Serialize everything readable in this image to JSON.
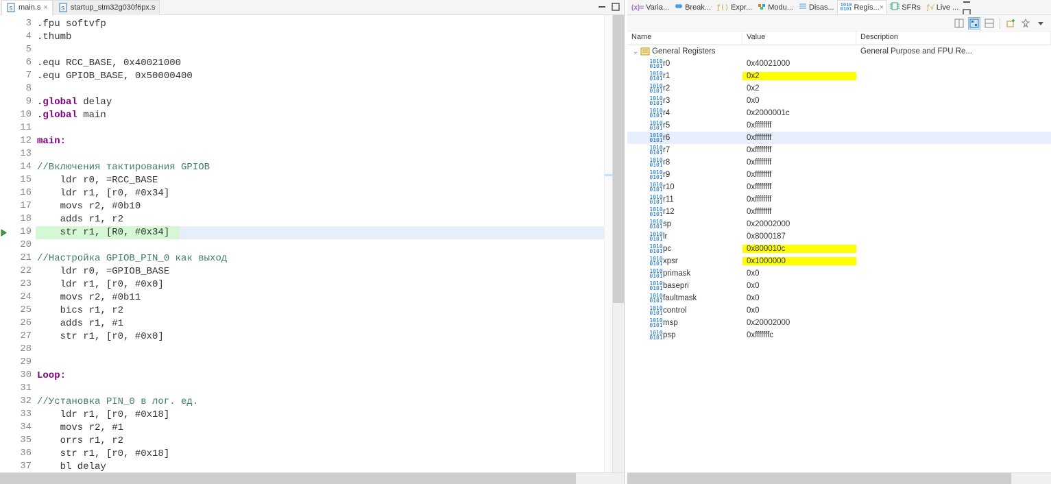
{
  "editor": {
    "tabs": [
      {
        "label": "main.s",
        "active": true
      },
      {
        "label": "startup_stm32g030f6px.s",
        "active": false
      }
    ],
    "current_line": 19,
    "exec_line": 19,
    "lines": [
      {
        "n": 3,
        "text": ".fpu softvfp"
      },
      {
        "n": 4,
        "text": ".thumb"
      },
      {
        "n": 5,
        "text": ""
      },
      {
        "n": 6,
        "text": ".equ RCC_BASE, 0x40021000"
      },
      {
        "n": 7,
        "text": ".equ GPIOB_BASE, 0x50000400"
      },
      {
        "n": 8,
        "text": ""
      },
      {
        "n": 9,
        "text": "",
        "tok": [
          {
            "t": ".global",
            "c": "dir"
          },
          {
            "t": " delay",
            "c": ""
          }
        ]
      },
      {
        "n": 10,
        "text": "",
        "tok": [
          {
            "t": ".global",
            "c": "dir"
          },
          {
            "t": " main",
            "c": ""
          }
        ]
      },
      {
        "n": 11,
        "text": ""
      },
      {
        "n": 12,
        "text": "",
        "tok": [
          {
            "t": "main:",
            "c": "label"
          }
        ]
      },
      {
        "n": 13,
        "text": ""
      },
      {
        "n": 14,
        "text": "",
        "tok": [
          {
            "t": "//Включения тактирования GPIOB",
            "c": "comment"
          }
        ]
      },
      {
        "n": 15,
        "text": "    ldr r0, =RCC_BASE"
      },
      {
        "n": 16,
        "text": "    ldr r1, [r0, #0x34]"
      },
      {
        "n": 17,
        "text": "    movs r2, #0b10"
      },
      {
        "n": 18,
        "text": "    adds r1, r2"
      },
      {
        "n": 19,
        "text": "    str r1, [R0, #0x34]"
      },
      {
        "n": 20,
        "text": ""
      },
      {
        "n": 21,
        "text": "",
        "tok": [
          {
            "t": "//Настройка GPIOB_PIN_0 как выход",
            "c": "comment"
          }
        ]
      },
      {
        "n": 22,
        "text": "    ldr r0, =GPIOB_BASE"
      },
      {
        "n": 23,
        "text": "    ldr r1, [r0, #0x0]"
      },
      {
        "n": 24,
        "text": "    movs r2, #0b11"
      },
      {
        "n": 25,
        "text": "    bics r1, r2"
      },
      {
        "n": 26,
        "text": "    adds r1, #1"
      },
      {
        "n": 27,
        "text": "    str r1, [r0, #0x0]"
      },
      {
        "n": 28,
        "text": ""
      },
      {
        "n": 29,
        "text": ""
      },
      {
        "n": 30,
        "text": "",
        "tok": [
          {
            "t": "Loop:",
            "c": "label"
          }
        ]
      },
      {
        "n": 31,
        "text": ""
      },
      {
        "n": 32,
        "text": "",
        "tok": [
          {
            "t": "//Установка PIN_0 в лог. ед.",
            "c": "comment"
          }
        ]
      },
      {
        "n": 33,
        "text": "    ldr r1, [r0, #0x18]"
      },
      {
        "n": 34,
        "text": "    movs r2, #1"
      },
      {
        "n": 35,
        "text": "    orrs r1, r2"
      },
      {
        "n": 36,
        "text": "    str r1, [r0, #0x18]"
      },
      {
        "n": 37,
        "text": "    bl delay"
      }
    ]
  },
  "inspector": {
    "tabs": [
      {
        "label": "Varia...",
        "icon": "vars"
      },
      {
        "label": "Break...",
        "icon": "break"
      },
      {
        "label": "Expr...",
        "icon": "expr"
      },
      {
        "label": "Modu...",
        "icon": "mod"
      },
      {
        "label": "Disas...",
        "icon": "dis"
      },
      {
        "label": "Regis...",
        "icon": "reg",
        "active": true
      },
      {
        "label": "SFRs",
        "icon": "sfr"
      },
      {
        "label": "Live ...",
        "icon": "live"
      }
    ],
    "columns": {
      "name": "Name",
      "value": "Value",
      "description": "Description"
    },
    "group": {
      "label": "General Registers",
      "desc": "General Purpose and FPU Re..."
    },
    "registers": [
      {
        "name": "r0",
        "value": "0x40021000"
      },
      {
        "name": "r1",
        "value": "0x2",
        "changed": true
      },
      {
        "name": "r2",
        "value": "0x2"
      },
      {
        "name": "r3",
        "value": "0x0"
      },
      {
        "name": "r4",
        "value": "0x2000001c"
      },
      {
        "name": "r5",
        "value": "0xffffffff"
      },
      {
        "name": "r6",
        "value": "0xffffffff",
        "selected": true
      },
      {
        "name": "r7",
        "value": "0xffffffff"
      },
      {
        "name": "r8",
        "value": "0xffffffff"
      },
      {
        "name": "r9",
        "value": "0xffffffff"
      },
      {
        "name": "r10",
        "value": "0xffffffff"
      },
      {
        "name": "r11",
        "value": "0xffffffff"
      },
      {
        "name": "r12",
        "value": "0xffffffff"
      },
      {
        "name": "sp",
        "value": "0x20002000"
      },
      {
        "name": "lr",
        "value": "0x8000187"
      },
      {
        "name": "pc",
        "value": "0x800010c",
        "changed": true
      },
      {
        "name": "xpsr",
        "value": "0x1000000",
        "changed": true
      },
      {
        "name": "primask",
        "value": "0x0"
      },
      {
        "name": "basepri",
        "value": "0x0"
      },
      {
        "name": "faultmask",
        "value": "0x0"
      },
      {
        "name": "control",
        "value": "0x0"
      },
      {
        "name": "msp",
        "value": "0x20002000"
      },
      {
        "name": "psp",
        "value": "0xfffffffc"
      }
    ]
  }
}
